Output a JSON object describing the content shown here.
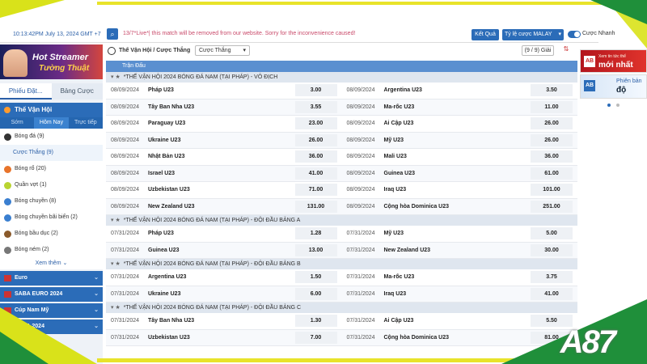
{
  "topbar": {
    "clock": "10:13:42PM July 13, 2024 GMT +7",
    "notice": "13/7*Live*| this match will be removed from our website. Sorry for the inconvenience caused!",
    "result_button": "Kết Quả",
    "odds_select": "Tỷ lệ cược MALAY",
    "toggle_label": "Cược Nhanh"
  },
  "sidebar": {
    "banner_line1": "Hot Streamer",
    "banner_line2": "Tường Thuật",
    "tabs": [
      "Phiếu Đặt...",
      "Bảng Cược"
    ],
    "sport_title": "Thế Vận Hội",
    "time_tabs": [
      "Sớm",
      "Hôm Nay",
      "Trực tiếp"
    ],
    "sports": [
      {
        "label": "Bóng đá",
        "count": "(9)",
        "color": "#333333"
      },
      {
        "label": "Cược Thắng",
        "count": "(9)",
        "sub": true
      },
      {
        "label": "Bóng rổ",
        "count": "(20)",
        "color": "#e8742b"
      },
      {
        "label": "Quần vợt",
        "count": "(1)",
        "color": "#b9d431"
      },
      {
        "label": "Bóng chuyền",
        "count": "(8)",
        "color": "#3a7fd0"
      },
      {
        "label": "Bóng chuyền bãi biển",
        "count": "(2)",
        "color": "#3a7fd0"
      },
      {
        "label": "Bóng bầu dục",
        "count": "(2)",
        "color": "#8a5a2b"
      },
      {
        "label": "Bóng ném",
        "count": "(2)",
        "color": "#777777"
      }
    ],
    "see_more": "Xem thêm",
    "leagues": [
      "Euro",
      "SABA EURO 2024",
      "Cúp Nam Mỹ",
      "COPA 2024"
    ]
  },
  "main": {
    "title": "Thế Vận Hội / Cược Thắng",
    "bet_type": "Cược Thắng",
    "count": "(9 / 9) Giải",
    "column_header": "Trận Đấu",
    "groups": [
      {
        "title": "*THẾ VẬN HỘI 2024 BÓNG ĐÁ NAM (TẠI PHÁP) - VÔ ĐỊCH",
        "rows": [
          [
            {
              "date": "08/09/2024",
              "team": "Pháp U23",
              "odd": "3.00"
            },
            {
              "date": "08/09/2024",
              "team": "Argentina U23",
              "odd": "3.50"
            }
          ],
          [
            {
              "date": "08/09/2024",
              "team": "Tây Ban Nha U23",
              "odd": "3.55"
            },
            {
              "date": "08/09/2024",
              "team": "Ma-rốc U23",
              "odd": "11.00"
            }
          ],
          [
            {
              "date": "08/09/2024",
              "team": "Paraguay U23",
              "odd": "23.00"
            },
            {
              "date": "08/09/2024",
              "team": "Ai Cập U23",
              "odd": "26.00"
            }
          ],
          [
            {
              "date": "08/09/2024",
              "team": "Ukraine U23",
              "odd": "26.00"
            },
            {
              "date": "08/09/2024",
              "team": "Mỹ U23",
              "odd": "26.00"
            }
          ],
          [
            {
              "date": "08/09/2024",
              "team": "Nhật Bản U23",
              "odd": "36.00"
            },
            {
              "date": "08/09/2024",
              "team": "Mali U23",
              "odd": "36.00"
            }
          ],
          [
            {
              "date": "08/09/2024",
              "team": "Israel U23",
              "odd": "41.00"
            },
            {
              "date": "08/09/2024",
              "team": "Guinea U23",
              "odd": "61.00"
            }
          ],
          [
            {
              "date": "08/09/2024",
              "team": "Uzbekistan U23",
              "odd": "71.00"
            },
            {
              "date": "08/09/2024",
              "team": "Iraq U23",
              "odd": "101.00"
            }
          ],
          [
            {
              "date": "08/09/2024",
              "team": "New Zealand U23",
              "odd": "131.00"
            },
            {
              "date": "08/09/2024",
              "team": "Cộng hòa Dominica U23",
              "odd": "251.00"
            }
          ]
        ]
      },
      {
        "title": "*THẾ VẬN HỘI 2024 BÓNG ĐÁ NAM (TẠI PHÁP) - ĐỘI ĐẦU BẢNG A",
        "rows": [
          [
            {
              "date": "07/31/2024",
              "team": "Pháp U23",
              "odd": "1.28"
            },
            {
              "date": "07/31/2024",
              "team": "Mỹ U23",
              "odd": "5.00"
            }
          ],
          [
            {
              "date": "07/31/2024",
              "team": "Guinea U23",
              "odd": "13.00"
            },
            {
              "date": "07/31/2024",
              "team": "New Zealand U23",
              "odd": "30.00"
            }
          ]
        ]
      },
      {
        "title": "*THẾ VẬN HỘI 2024 BÓNG ĐÁ NAM (TẠI PHÁP) - ĐỘI ĐẦU BẢNG B",
        "rows": [
          [
            {
              "date": "07/31/2024",
              "team": "Argentina U23",
              "odd": "1.50"
            },
            {
              "date": "07/31/2024",
              "team": "Ma-rốc U23",
              "odd": "3.75"
            }
          ],
          [
            {
              "date": "07/31/2024",
              "team": "Ukraine U23",
              "odd": "6.00"
            },
            {
              "date": "07/31/2024",
              "team": "Iraq U23",
              "odd": "41.00"
            }
          ]
        ]
      },
      {
        "title": "*THẾ VẬN HỘI 2024 BÓNG ĐÁ NAM (TẠI PHÁP) - ĐỘI ĐẦU BẢNG C",
        "rows": [
          [
            {
              "date": "07/31/2024",
              "team": "Tây Ban Nha U23",
              "odd": "1.30"
            },
            {
              "date": "07/31/2024",
              "team": "Ai Cập U23",
              "odd": "5.50"
            }
          ],
          [
            {
              "date": "07/31/2024",
              "team": "Uzbekistan U23",
              "odd": "7.00"
            },
            {
              "date": "07/31/2024",
              "team": "Cộng hòa Dominica U23",
              "odd": "81.00"
            }
          ]
        ]
      }
    ]
  },
  "right": {
    "promo1_small": "Xem tin tức thể",
    "promo1_big": "mới nhất",
    "promo2_line1": "Phiên bản",
    "promo2_line2": "độ"
  },
  "brand": "A87",
  "colors": {
    "accent": "#2b6cb8",
    "frame_yellow": "#d9e21a",
    "frame_green": "#1f8f3a"
  }
}
